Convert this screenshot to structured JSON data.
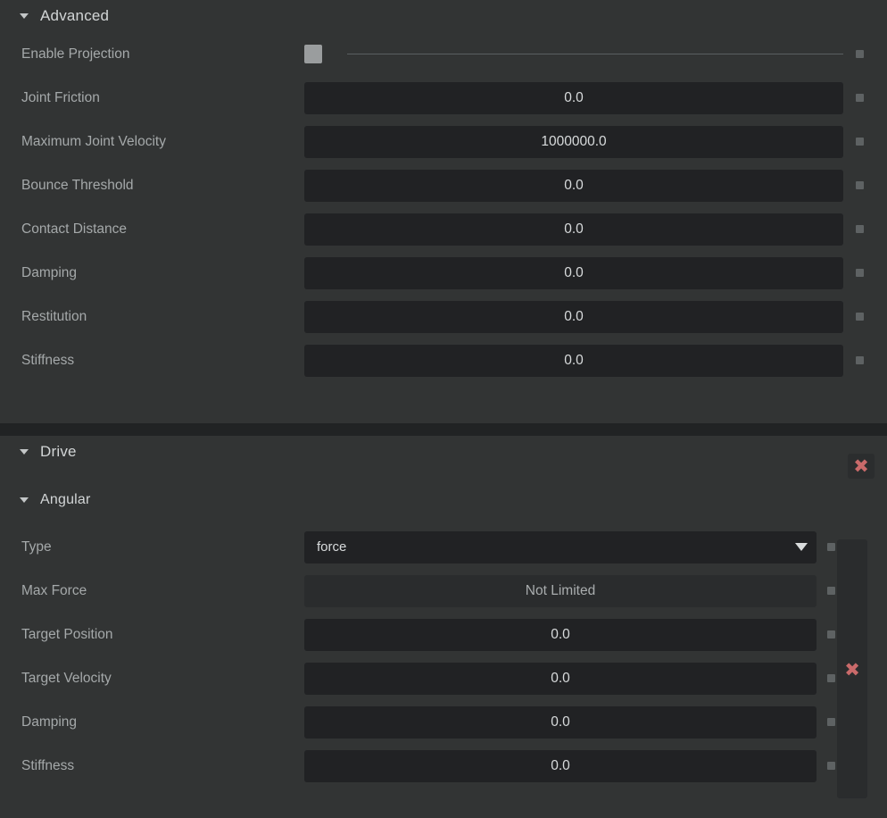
{
  "advanced": {
    "title": "Advanced",
    "collapse_icon": "triangle-down-icon",
    "rows": [
      {
        "label": "Enable Projection",
        "type": "checkbox",
        "value": "",
        "checked": false
      },
      {
        "label": "Joint Friction",
        "type": "number",
        "value": "0.0"
      },
      {
        "label": "Maximum Joint Velocity",
        "type": "number",
        "value": "1000000.0"
      },
      {
        "label": "Bounce Threshold",
        "type": "number",
        "value": "0.0"
      },
      {
        "label": "Contact Distance",
        "type": "number",
        "value": "0.0"
      },
      {
        "label": "Damping",
        "type": "number",
        "value": "0.0"
      },
      {
        "label": "Restitution",
        "type": "number",
        "value": "0.0"
      },
      {
        "label": "Stiffness",
        "type": "number",
        "value": "0.0"
      }
    ]
  },
  "drive": {
    "title": "Drive",
    "collapse_icon": "triangle-down-icon",
    "remove_icon": "close-x-icon",
    "angular": {
      "title": "Angular",
      "collapse_icon": "triangle-down-icon",
      "remove_icon": "close-x-icon",
      "rows": [
        {
          "label": "Type",
          "type": "dropdown",
          "value": "force"
        },
        {
          "label": "Max Force",
          "type": "disabled",
          "value": "Not Limited"
        },
        {
          "label": "Target Position",
          "type": "number",
          "value": "0.0"
        },
        {
          "label": "Target Velocity",
          "type": "number",
          "value": "0.0"
        },
        {
          "label": "Damping",
          "type": "number",
          "value": "0.0"
        },
        {
          "label": "Stiffness",
          "type": "number",
          "value": "0.0"
        }
      ]
    }
  },
  "colors": {
    "panel_bg": "#323434",
    "field_bg": "#212224",
    "gap_bg": "#212324",
    "label_text": "#a5a9aa",
    "value_text": "#d8dbdc",
    "header_text": "#d2d5d6",
    "accent_remove": "#c96a6a",
    "marker": "#5e6263",
    "checkbox": "#9a9d9e"
  }
}
